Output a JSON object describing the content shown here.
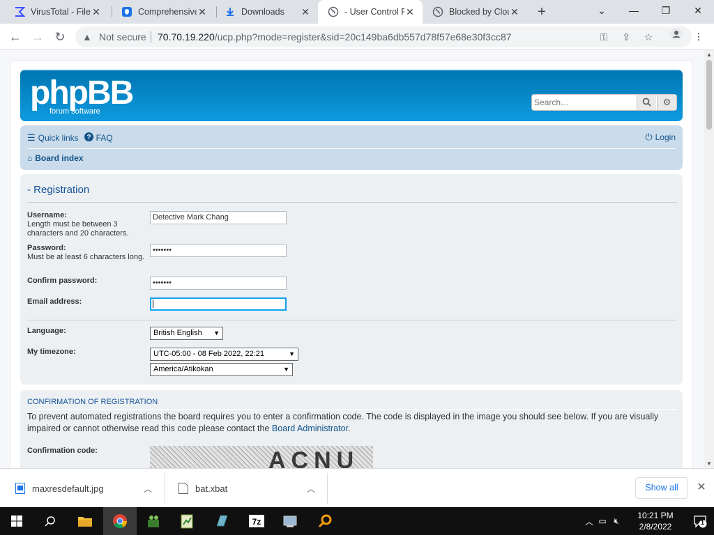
{
  "browser": {
    "tabs": [
      {
        "title": "VirusTotal - File",
        "icon": "virustotal-icon",
        "color": "#394eff"
      },
      {
        "title": "Comprehensive",
        "icon": "shield-icon",
        "color": "#1a73e8"
      },
      {
        "title": "Downloads",
        "icon": "download-icon",
        "color": "#1a73e8"
      },
      {
        "title": "- User Control P",
        "icon": "globe-icon",
        "color": "#5f6368"
      },
      {
        "title": "Blocked by Clou",
        "icon": "globe-icon",
        "color": "#5f6368"
      }
    ],
    "active_tab": 3,
    "security_label": "Not secure",
    "url_host": "70.70.19.220",
    "url_path": "/ucp.php?mode=register&sid=20c149ba6db557d78f57e68e30f3cc87"
  },
  "forum": {
    "logo_text": "phpBB",
    "logo_sub": "forum software",
    "search_placeholder": "Search…",
    "nav": {
      "quick_links": "Quick links",
      "faq": "FAQ",
      "login": "Login",
      "board_index": "Board index"
    },
    "registration": {
      "heading": "- Registration",
      "fields": {
        "username_label": "Username:",
        "username_explain": "Length must be between 3 characters and 20 characters.",
        "username_value": "Detective Mark Chang",
        "password_label": "Password:",
        "password_explain": "Must be at least 6 characters long.",
        "password_value": "•••••••",
        "confirm_label": "Confirm password:",
        "confirm_value": "•••••••",
        "email_label": "Email address:",
        "email_value": "",
        "language_label": "Language:",
        "language_value": "British English",
        "timezone_label": "My timezone:",
        "timezone_value": "UTC-05:00 - 08 Feb 2022, 22:21",
        "timezone_region": "America/Atikokan"
      }
    },
    "confirmation": {
      "heading": "Confirmation of registration",
      "text_before": "To prevent automated registrations the board requires you to enter a confirmation code. The code is displayed in the image you should see below. If you are visually impaired or cannot otherwise read this code please contact the ",
      "link": "Board Administrator",
      "text_after": ".",
      "code_label": "Confirmation code:",
      "captcha_text": "ACNU"
    }
  },
  "downloads": {
    "items": [
      {
        "name": "maxresdefault.jpg"
      },
      {
        "name": "bat.xbat"
      }
    ],
    "show_all": "Show all"
  },
  "taskbar": {
    "time": "10:21 PM",
    "date": "2/8/2022",
    "notifications": "1"
  }
}
